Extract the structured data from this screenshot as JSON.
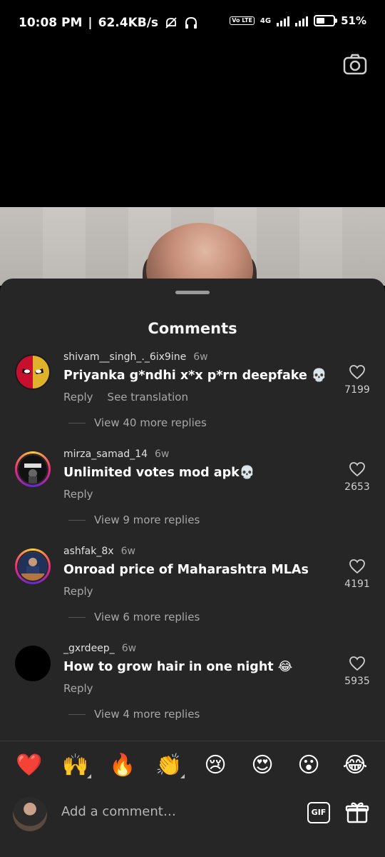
{
  "status_bar": {
    "time": "10:08 PM",
    "network_speed": "62.4KB/s",
    "network_type": "4G",
    "volte": "Vo LTE",
    "battery_percent": "51%",
    "battery_level": 0.51
  },
  "sheet": {
    "title": "Comments"
  },
  "comments": [
    {
      "username": "shivam__singh_._6ix9ine",
      "age": "6w",
      "text": "Priyanka g*ndhi x*x p*rn deepfake 💀",
      "reply_label": "Reply",
      "translate_label": "See translation",
      "likes": "7199",
      "view_replies": "View 40 more replies"
    },
    {
      "username": "mirza_samad_14",
      "age": "6w",
      "text": "Unlimited votes mod apk💀",
      "reply_label": "Reply",
      "likes": "2653",
      "view_replies": "View 9 more replies"
    },
    {
      "username": "ashfak_8x",
      "age": "6w",
      "text": "Onroad price of Maharashtra MLAs",
      "reply_label": "Reply",
      "likes": "4191",
      "view_replies": "View 6 more replies"
    },
    {
      "username": "_gxrdeep_",
      "age": "6w",
      "text": "How to grow hair in one night 😂",
      "reply_label": "Reply",
      "likes": "5935",
      "view_replies": "View 4 more replies"
    }
  ],
  "quick_reactions": [
    "❤️",
    "🙌",
    "🔥",
    "👏",
    "😢",
    "😍",
    "😮",
    "😂"
  ],
  "composer": {
    "placeholder": "Add a comment…",
    "gif_label": "GIF"
  },
  "colors": {
    "sheet_background": "#262626",
    "secondary_text": "#a8a8a8",
    "story_ring": "#ee2a7b"
  }
}
